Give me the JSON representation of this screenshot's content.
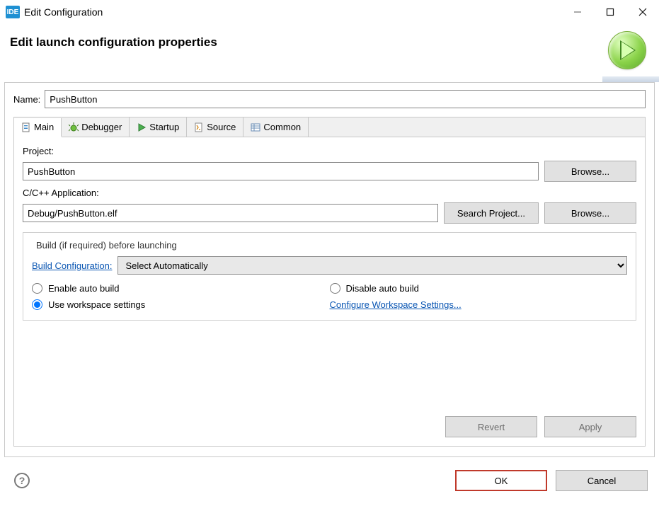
{
  "window": {
    "app_badge": "IDE",
    "title": "Edit Configuration"
  },
  "header": {
    "title": "Edit launch configuration properties"
  },
  "name_field": {
    "label": "Name:",
    "value": "PushButton"
  },
  "tabs": {
    "main": "Main",
    "debugger": "Debugger",
    "startup": "Startup",
    "source": "Source",
    "common": "Common"
  },
  "main_tab": {
    "project_label": "Project:",
    "project_value": "PushButton",
    "project_browse": "Browse...",
    "app_label": "C/C++ Application:",
    "app_value": "Debug/PushButton.elf",
    "app_search": "Search Project...",
    "app_browse": "Browse...",
    "group_title": "Build (if required) before launching",
    "build_config_label": "Build Configuration:",
    "build_config_value": "Select Automatically",
    "radio_enable": "Enable auto build",
    "radio_disable": "Disable auto build",
    "radio_workspace": "Use workspace settings",
    "configure_link": "Configure Workspace Settings..."
  },
  "panel_buttons": {
    "revert": "Revert",
    "apply": "Apply"
  },
  "footer": {
    "ok": "OK",
    "cancel": "Cancel",
    "help_glyph": "?"
  }
}
